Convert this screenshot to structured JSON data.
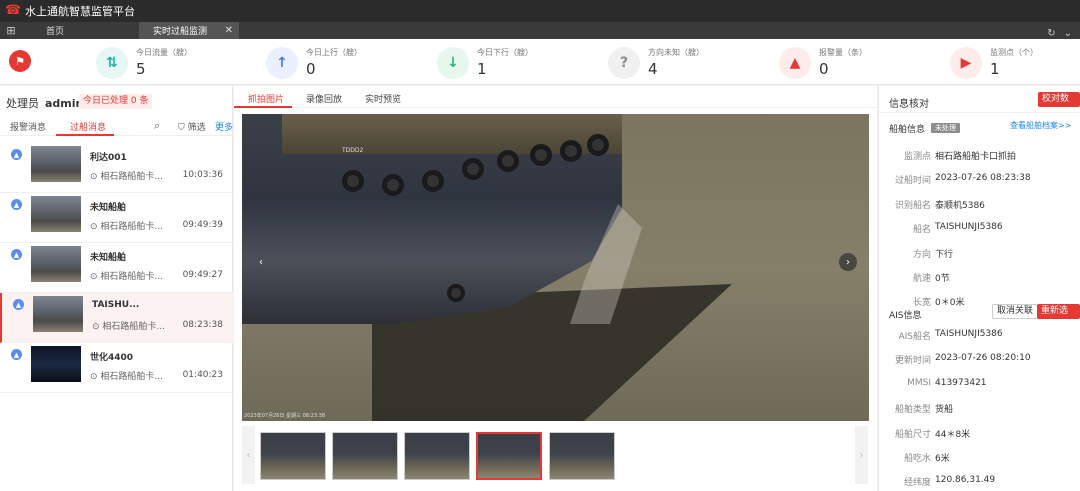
{
  "app": {
    "title": "水上通航智慧监管平台",
    "user": "admin"
  },
  "tabs": [
    {
      "label": "首页"
    },
    {
      "label": "实时过船监测",
      "close": "✕"
    }
  ],
  "stats": [
    {
      "label": "今日流量（艘）",
      "value": "5",
      "color": "#20b3a8",
      "bg": "#e6f7f5",
      "glyph": "⇅"
    },
    {
      "label": "今日上行（艘）",
      "value": "0",
      "color": "#4a7ae8",
      "bg": "#eaf0fd",
      "glyph": "↑"
    },
    {
      "label": "今日下行（艘）",
      "value": "1",
      "color": "#2bb673",
      "bg": "#e7f7ee",
      "glyph": "↓"
    },
    {
      "label": "方向未知（艘）",
      "value": "4",
      "color": "#8d8d8d",
      "bg": "#f0f0f0",
      "glyph": "?"
    },
    {
      "label": "报警量（条）",
      "value": "0",
      "color": "#e53935",
      "bg": "#fdecea",
      "glyph": "▲"
    },
    {
      "label": "监测点（个）",
      "value": "1",
      "color": "#e53935",
      "bg": "#fdecea",
      "glyph": "▶"
    }
  ],
  "left": {
    "handler_label": "处理员",
    "handler_name": "admin",
    "today_processed": "今日已处理 0 条",
    "tab_alarm": "报警消息",
    "tab_passing": "过船消息",
    "filter": "筛选",
    "more": "更多",
    "items": [
      {
        "name": "利达001",
        "loc": "相石路船舶卡...",
        "time": "10:03:36",
        "night": false
      },
      {
        "name": "未知船舶",
        "loc": "相石路船舶卡...",
        "time": "09:49:39",
        "night": false
      },
      {
        "name": "未知船舶",
        "loc": "相石路船舶卡...",
        "time": "09:49:27",
        "night": false
      },
      {
        "name": "TAISHU...",
        "loc": "相石路船舶卡...",
        "time": "08:23:38",
        "night": false
      },
      {
        "name": "世化4400",
        "loc": "相石路船舶卡...",
        "time": "01:40:23",
        "night": true
      }
    ]
  },
  "middle": {
    "tab_capture": "抓拍图片",
    "tab_playback": "录像回放",
    "tab_live": "实时预览",
    "image_caption": "2023年07月26日 星期三 08:23:38",
    "hull_text": "TDDD2"
  },
  "right": {
    "title": "信息核对",
    "verify_btn": "校对数据",
    "ship_info": "船舶信息",
    "status": "未处理",
    "archive_link": "查看船舶档案>>",
    "ship_rows": [
      {
        "k": "监测点",
        "v": "相石路船舶卡口抓拍"
      },
      {
        "k": "过船时间",
        "v": "2023-07-26 08:23:38"
      },
      {
        "k": "识别船名",
        "v": "泰顺机5386"
      },
      {
        "k": "船名",
        "v": "TAISHUNJI5386"
      },
      {
        "k": "方向",
        "v": "下行"
      },
      {
        "k": "航速",
        "v": "0节"
      },
      {
        "k": "长宽",
        "v": "0＊0米"
      }
    ],
    "ais_info": "AIS信息",
    "unlink_btn": "取消关联",
    "reselect_btn": "重新选择",
    "ais_rows": [
      {
        "k": "AIS船名",
        "v": "TAISHUNJI5386"
      },
      {
        "k": "更新时间",
        "v": "2023-07-26 08:20:10"
      },
      {
        "k": "MMSI",
        "v": "413973421"
      },
      {
        "k": "船舶类型",
        "v": "货船"
      },
      {
        "k": "船舶尺寸",
        "v": "44＊8米"
      },
      {
        "k": "船吃水",
        "v": "6米"
      },
      {
        "k": "经纬度",
        "v": "120.86,31.49"
      }
    ]
  }
}
